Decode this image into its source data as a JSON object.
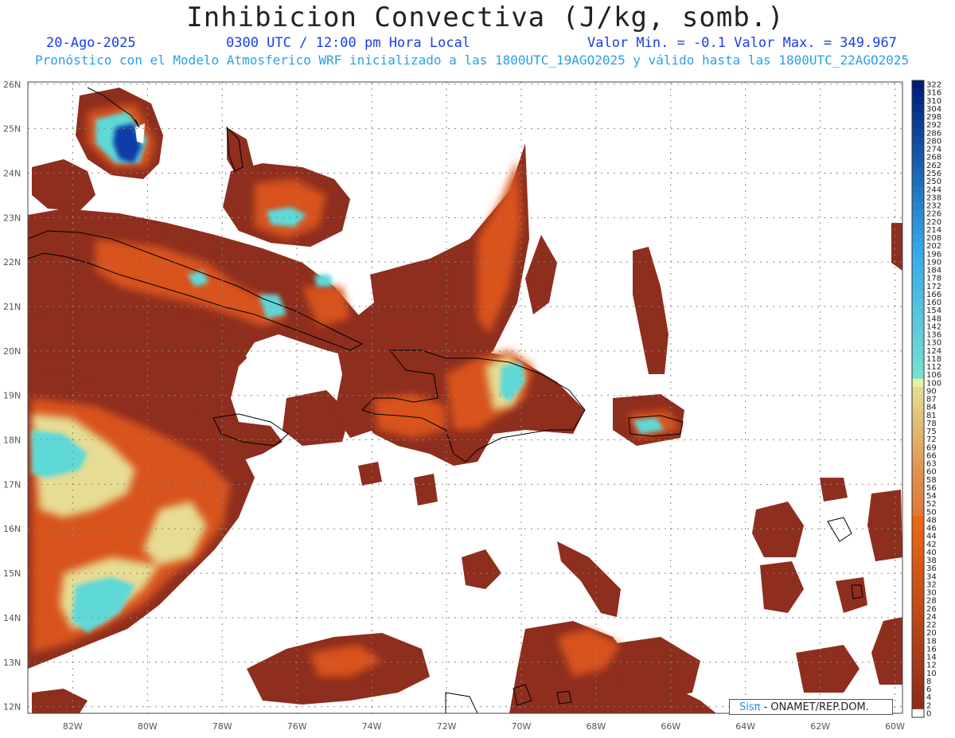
{
  "header": {
    "title": "Inhibicion Convectiva (J/kg, somb.)",
    "date": "20-Ago-2025",
    "time": "0300 UTC / 12:00 pm Hora Local",
    "min_max": "Valor Min. = -0.1  Valor Max. = 349.967",
    "model_info": "Pronóstico con el Modelo Atmosferico WRF inicializado a las 1800UTC_19AGO2025 y válido hasta las  1800UTC_22AGO2025"
  },
  "map": {
    "lat_labels": [
      "26N",
      "25N",
      "24N",
      "23N",
      "22N",
      "21N",
      "20N",
      "19N",
      "18N",
      "17N",
      "16N",
      "15N",
      "14N",
      "13N",
      "12N"
    ],
    "lon_labels": [
      "82W",
      "80W",
      "78W",
      "76W",
      "74W",
      "72W",
      "70W",
      "68W",
      "66W",
      "64W",
      "62W",
      "60W"
    ],
    "extent": {
      "lon_min": -83.2,
      "lon_max": -59.8,
      "lat_min": 11.85,
      "lat_max": 26.05
    }
  },
  "colorbar": {
    "labels": [
      "322",
      "316",
      "310",
      "304",
      "298",
      "292",
      "286",
      "280",
      "274",
      "268",
      "262",
      "256",
      "250",
      "244",
      "238",
      "232",
      "226",
      "220",
      "214",
      "208",
      "202",
      "196",
      "190",
      "184",
      "178",
      "172",
      "166",
      "160",
      "154",
      "148",
      "142",
      "136",
      "130",
      "124",
      "118",
      "112",
      "106",
      "100",
      "90",
      "87",
      "84",
      "81",
      "78",
      "75",
      "72",
      "69",
      "66",
      "63",
      "60",
      "58",
      "56",
      "54",
      "52",
      "50",
      "48",
      "46",
      "44",
      "42",
      "40",
      "38",
      "36",
      "34",
      "32",
      "30",
      "28",
      "26",
      "24",
      "22",
      "20",
      "18",
      "16",
      "14",
      "12",
      "10",
      "8",
      "6",
      "4",
      "2",
      "0"
    ]
  },
  "colors": {
    "low": "#8e2e1e",
    "mid": "#e8661c",
    "high": "#e9e09a",
    "very_high": "#5ed8d8",
    "extreme": "#0a2a9a"
  },
  "credit": {
    "brand": "Sisπ",
    "text": " - ONAMET/REP.DOM."
  }
}
